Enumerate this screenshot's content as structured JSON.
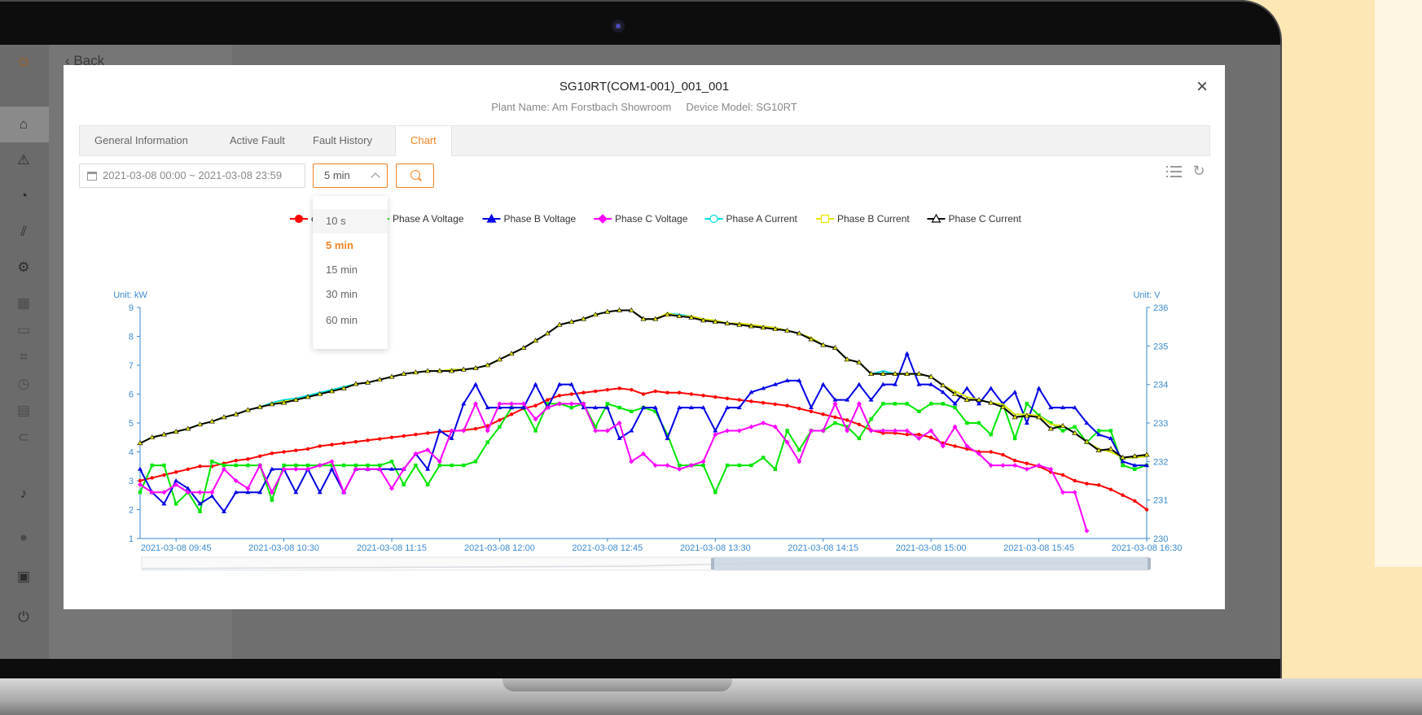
{
  "app": {
    "back_label": "Back"
  },
  "modal": {
    "title": "SG10RT(COM1-001)_001_001",
    "plant_name": "Plant Name: Am Forstbach Showroom",
    "device_model": "Device Model: SG10RT",
    "close_label": "×"
  },
  "tabs": [
    {
      "label": "General Information"
    },
    {
      "label": "Active Fault"
    },
    {
      "label": "Fault History"
    },
    {
      "label": "Chart",
      "active": true
    }
  ],
  "toolbar": {
    "date_range": "2021-03-08 00:00  ~  2021-03-08 23:59",
    "interval": "5 min"
  },
  "dropdown": {
    "options": [
      "10 s",
      "5 min",
      "15 min",
      "30 min",
      "60 min"
    ],
    "selected": "5 min",
    "hovered": "10 s"
  },
  "icons": {
    "refresh": "↻"
  },
  "colors": {
    "accent": "#f4821f",
    "axis": "#3a8ad0"
  },
  "chart_data": {
    "type": "line",
    "left_axis_label": "Unit: kW",
    "right_axis_label": "Unit: V",
    "left_ylim": [
      1,
      9
    ],
    "right_ylim": [
      230,
      236
    ],
    "left_ticks": [
      "1",
      "2",
      "3",
      "4",
      "5",
      "6",
      "7",
      "8",
      "9"
    ],
    "right_ticks": [
      "230",
      "231",
      "232",
      "233",
      "234",
      "235",
      "236"
    ],
    "x_ticks": [
      "2021-03-08 09:45",
      "2021-03-08 10:30",
      "2021-03-08 11:15",
      "2021-03-08 12:00",
      "2021-03-08 12:45",
      "2021-03-08 13:30",
      "2021-03-08 14:15",
      "2021-03-08 15:00",
      "2021-03-08 15:45",
      "2021-03-08 16:30"
    ],
    "x_start": "2021-03-08 09:30",
    "x_end": "2021-03-08 16:30",
    "interval_minutes": 5,
    "series": [
      {
        "name": "er",
        "color": "#ff0000",
        "marker": "circle",
        "axis": "left",
        "values": [
          3.0,
          3.1,
          3.2,
          3.3,
          3.4,
          3.5,
          3.5,
          3.6,
          3.7,
          3.75,
          3.85,
          3.95,
          4.0,
          4.05,
          4.1,
          4.2,
          4.25,
          4.3,
          4.35,
          4.4,
          4.45,
          4.5,
          4.55,
          4.6,
          4.65,
          4.7,
          4.72,
          4.75,
          4.8,
          4.9,
          5.1,
          5.3,
          5.5,
          5.6,
          5.8,
          5.95,
          6.0,
          6.05,
          6.1,
          6.15,
          6.2,
          6.15,
          6.0,
          6.1,
          6.05,
          6.05,
          6.0,
          5.95,
          5.9,
          5.85,
          5.8,
          5.75,
          5.7,
          5.65,
          5.6,
          5.5,
          5.4,
          5.3,
          5.2,
          5.1,
          4.95,
          4.75,
          4.65,
          4.65,
          4.6,
          4.6,
          4.5,
          4.3,
          4.2,
          4.1,
          4.0,
          4.0,
          3.9,
          3.7,
          3.6,
          3.5,
          3.3,
          3.2,
          3.0,
          2.9,
          2.85,
          2.7,
          2.5,
          2.3,
          2.0
        ]
      },
      {
        "name": "Phase A Voltage",
        "color": "#00e600",
        "marker": "square",
        "axis": "right",
        "values": [
          231.2,
          231.9,
          231.9,
          230.9,
          231.2,
          230.7,
          232.0,
          231.9,
          231.9,
          231.9,
          231.9,
          231.0,
          231.9,
          231.9,
          231.9,
          231.9,
          231.9,
          231.9,
          231.9,
          231.9,
          231.9,
          232.0,
          231.4,
          231.9,
          231.4,
          231.9,
          231.9,
          231.9,
          232.0,
          232.5,
          232.9,
          233.4,
          233.4,
          232.8,
          233.5,
          233.5,
          233.4,
          233.5,
          232.9,
          233.5,
          233.4,
          233.3,
          233.4,
          233.3,
          232.7,
          231.9,
          231.9,
          231.9,
          231.2,
          231.9,
          231.9,
          231.9,
          232.1,
          231.8,
          232.8,
          232.3,
          232.8,
          232.8,
          233.0,
          232.9,
          232.6,
          233.1,
          233.5,
          233.5,
          233.5,
          233.3,
          233.5,
          233.5,
          233.4,
          233.0,
          233.0,
          232.7,
          233.5,
          232.6,
          233.5,
          233.2,
          233.0,
          232.8,
          232.9,
          232.5,
          232.8,
          232.8,
          231.9,
          231.8,
          231.9
        ]
      },
      {
        "name": "Phase B Voltage",
        "color": "#0000e6",
        "marker": "triangle",
        "axis": "right",
        "values": [
          231.8,
          231.2,
          230.9,
          231.5,
          231.3,
          230.9,
          231.1,
          230.7,
          231.2,
          231.2,
          231.2,
          231.8,
          231.8,
          231.2,
          231.8,
          231.2,
          231.8,
          231.2,
          231.8,
          231.8,
          231.8,
          231.8,
          231.8,
          232.2,
          231.8,
          232.8,
          232.6,
          233.5,
          234.0,
          233.4,
          233.4,
          233.4,
          233.4,
          234.0,
          233.4,
          234.0,
          234.0,
          233.4,
          233.4,
          233.4,
          232.6,
          232.8,
          233.4,
          233.4,
          232.6,
          233.4,
          233.4,
          233.4,
          232.8,
          233.4,
          233.4,
          233.8,
          233.9,
          234.0,
          234.1,
          234.1,
          233.4,
          234.0,
          233.6,
          233.6,
          234.0,
          233.6,
          234.0,
          234.0,
          234.8,
          234.0,
          234.0,
          233.8,
          233.5,
          233.9,
          233.5,
          233.9,
          233.5,
          233.8,
          233.0,
          233.9,
          233.4,
          233.4,
          233.4,
          233.0,
          232.7,
          232.6,
          232.0,
          231.9,
          231.9
        ]
      },
      {
        "name": "Phase C Voltage",
        "color": "#ff00ff",
        "marker": "diamond",
        "axis": "right",
        "values": [
          231.4,
          231.2,
          231.2,
          231.4,
          231.2,
          231.2,
          231.2,
          231.8,
          231.5,
          231.3,
          231.9,
          231.2,
          231.8,
          231.8,
          231.8,
          231.9,
          232.0,
          231.2,
          231.8,
          231.8,
          231.8,
          231.3,
          231.8,
          232.2,
          232.3,
          232.0,
          232.8,
          232.8,
          233.5,
          232.8,
          233.5,
          233.5,
          233.5,
          233.1,
          233.4,
          233.5,
          233.5,
          233.5,
          232.8,
          232.8,
          233.0,
          232.0,
          232.2,
          231.9,
          231.9,
          231.8,
          231.9,
          232.0,
          232.7,
          232.8,
          232.8,
          232.9,
          233.0,
          232.9,
          232.5,
          232.0,
          232.8,
          232.8,
          233.5,
          232.8,
          233.5,
          232.8,
          232.8,
          232.8,
          232.8,
          232.6,
          232.8,
          232.4,
          232.9,
          232.4,
          232.2,
          231.9,
          231.9,
          231.9,
          231.8,
          231.9,
          231.8,
          231.2,
          231.2,
          230.2
        ]
      },
      {
        "name": "Phase A Current",
        "color": "#00dddd",
        "marker": "circle-open",
        "axis": "left",
        "values": [
          4.3,
          4.5,
          4.6,
          4.7,
          4.8,
          4.95,
          5.05,
          5.2,
          5.3,
          5.45,
          5.55,
          5.7,
          5.8,
          5.85,
          5.95,
          6.05,
          6.15,
          6.25,
          6.35,
          6.4,
          6.5,
          6.6,
          6.7,
          6.75,
          6.8,
          6.8,
          6.85,
          6.85,
          6.9,
          7.0,
          7.2,
          7.4,
          7.6,
          7.85,
          8.1,
          8.4,
          8.5,
          8.6,
          8.75,
          8.85,
          8.9,
          8.9,
          8.6,
          8.6,
          8.8,
          8.75,
          8.7,
          8.6,
          8.55,
          8.45,
          8.45,
          8.4,
          8.35,
          8.3,
          8.2,
          8.1,
          7.95,
          7.7,
          7.6,
          7.2,
          7.1,
          6.7,
          6.8,
          6.7,
          6.7,
          6.7,
          6.6,
          6.3,
          6.1,
          5.9,
          5.8,
          5.7,
          5.65,
          5.3,
          5.3,
          5.25,
          4.95,
          4.9,
          4.65,
          4.35,
          4.1,
          4.0,
          3.8,
          3.8,
          3.85,
          3.6,
          3.4,
          3.2,
          2.8
        ]
      },
      {
        "name": "Phase B Current",
        "color": "#e6e600",
        "marker": "square-open",
        "axis": "left",
        "values": [
          4.3,
          4.5,
          4.6,
          4.7,
          4.8,
          4.95,
          5.05,
          5.2,
          5.3,
          5.45,
          5.55,
          5.65,
          5.75,
          5.8,
          5.9,
          6.0,
          6.1,
          6.2,
          6.35,
          6.4,
          6.5,
          6.6,
          6.7,
          6.75,
          6.8,
          6.8,
          6.85,
          6.85,
          6.9,
          7.0,
          7.2,
          7.4,
          7.6,
          7.85,
          8.1,
          8.4,
          8.5,
          8.6,
          8.75,
          8.85,
          8.9,
          8.9,
          8.6,
          8.6,
          8.8,
          8.7,
          8.7,
          8.6,
          8.55,
          8.45,
          8.45,
          8.4,
          8.35,
          8.3,
          8.2,
          8.1,
          7.95,
          7.7,
          7.6,
          7.2,
          7.1,
          6.7,
          6.7,
          6.7,
          6.7,
          6.7,
          6.6,
          6.3,
          6.1,
          5.9,
          5.8,
          5.7,
          5.65,
          5.3,
          5.3,
          5.25,
          4.95,
          4.9,
          4.65,
          4.35,
          4.1,
          4.0,
          3.8,
          3.8,
          3.85,
          3.6,
          3.4,
          3.2,
          2.8
        ]
      },
      {
        "name": "Phase C Current",
        "color": "#000000",
        "marker": "triangle-open",
        "axis": "left",
        "values": [
          4.3,
          4.5,
          4.6,
          4.7,
          4.8,
          4.95,
          5.05,
          5.2,
          5.3,
          5.45,
          5.55,
          5.65,
          5.7,
          5.8,
          5.9,
          6.0,
          6.1,
          6.2,
          6.35,
          6.4,
          6.5,
          6.6,
          6.7,
          6.75,
          6.8,
          6.8,
          6.8,
          6.85,
          6.9,
          7.0,
          7.2,
          7.4,
          7.6,
          7.85,
          8.1,
          8.4,
          8.5,
          8.6,
          8.75,
          8.85,
          8.9,
          8.9,
          8.6,
          8.6,
          8.75,
          8.7,
          8.65,
          8.55,
          8.5,
          8.45,
          8.4,
          8.35,
          8.3,
          8.25,
          8.2,
          8.1,
          7.9,
          7.7,
          7.6,
          7.2,
          7.1,
          6.7,
          6.7,
          6.7,
          6.7,
          6.7,
          6.6,
          6.3,
          6.0,
          5.8,
          5.8,
          5.7,
          5.55,
          5.2,
          5.25,
          5.2,
          4.8,
          4.9,
          4.65,
          4.35,
          4.05,
          4.1,
          3.8,
          3.85,
          3.9,
          3.6,
          3.4,
          3.2,
          2.75
        ]
      }
    ]
  }
}
